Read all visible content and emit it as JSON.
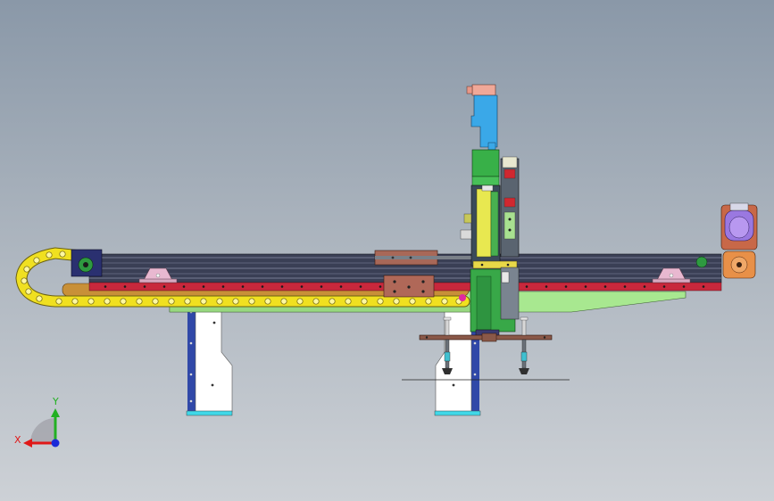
{
  "window": {
    "viewport_background_top": "#8a98a8",
    "viewport_background_bottom": "#cdd1d6"
  },
  "triad": {
    "x_label": "X",
    "y_label": "Y",
    "x_color": "#e01818",
    "y_color": "#22b022",
    "z_color": "#1a2ad8"
  },
  "colors": {
    "beam_dark": "#3a3f55",
    "rail_red": "#c8283c",
    "chain_yellow": "#f0e020",
    "leg_blue": "#3048a8",
    "leg_white": "#ffffff",
    "leg_foot": "#40d8e8",
    "plate_green": "#a8e890",
    "column_green": "#38b048",
    "column_yellow": "#e8e850",
    "top_blue": "#3aa8e8",
    "top_pink": "#f0a898",
    "motor_purple": "#9a78e0",
    "gearbox_orange": "#e89048",
    "block_brown": "#b06858",
    "gripper_plate": "#8a5848",
    "bracket_pink": "#e8b8d0"
  }
}
